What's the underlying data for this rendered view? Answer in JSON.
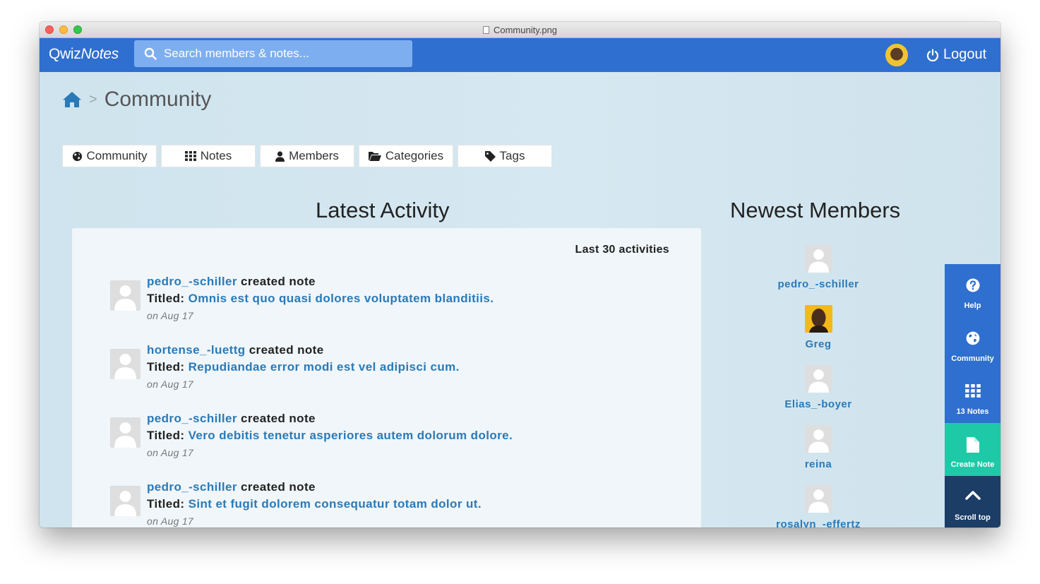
{
  "window": {
    "title": "Community.png"
  },
  "navbar": {
    "brand_a": "Qwiz",
    "brand_b": "Notes",
    "search_placeholder": "Search members & notes...",
    "logout_label": "Logout"
  },
  "breadcrumb": {
    "current": "Community",
    "separator": ">"
  },
  "tabs": [
    {
      "label": "Community",
      "icon": "globe-icon"
    },
    {
      "label": "Notes",
      "icon": "grid-icon"
    },
    {
      "label": "Members",
      "icon": "user-icon"
    },
    {
      "label": "Categories",
      "icon": "folder-open-icon"
    },
    {
      "label": "Tags",
      "icon": "tag-icon"
    }
  ],
  "activity": {
    "heading": "Latest Activity",
    "count_label": "Last 30 activities",
    "items": [
      {
        "user": "pedro_-schiller",
        "action": "created note",
        "titled_label": "Titled:",
        "note": "Omnis est quo quasi dolores voluptatem blanditiis.",
        "date": "on Aug 17"
      },
      {
        "user": "hortense_-luettg",
        "action": "created note",
        "titled_label": "Titled:",
        "note": "Repudiandae error modi est vel adipisci cum.",
        "date": "on Aug 17"
      },
      {
        "user": "pedro_-schiller",
        "action": "created note",
        "titled_label": "Titled:",
        "note": "Vero debitis tenetur asperiores autem dolorum dolore.",
        "date": "on Aug 17"
      },
      {
        "user": "pedro_-schiller",
        "action": "created note",
        "titled_label": "Titled:",
        "note": "Sint et fugit dolorem consequatur totam dolor ut.",
        "date": "on Aug 17"
      }
    ]
  },
  "members": {
    "heading": "Newest Members",
    "items": [
      {
        "name": "pedro_-schiller"
      },
      {
        "name": "Greg"
      },
      {
        "name": "Elias_-boyer"
      },
      {
        "name": "reina"
      },
      {
        "name": "rosalyn_-effertz"
      }
    ]
  },
  "sidebar": {
    "help": "Help",
    "community": "Community",
    "notes": "13 Notes",
    "create": "Create Note",
    "scroll": "Scroll top"
  },
  "colors": {
    "navbar": "#2f6fcf",
    "link": "#2a7ab8",
    "create_accent": "#1ec9a8",
    "scroll_dark": "#1b3d66"
  }
}
